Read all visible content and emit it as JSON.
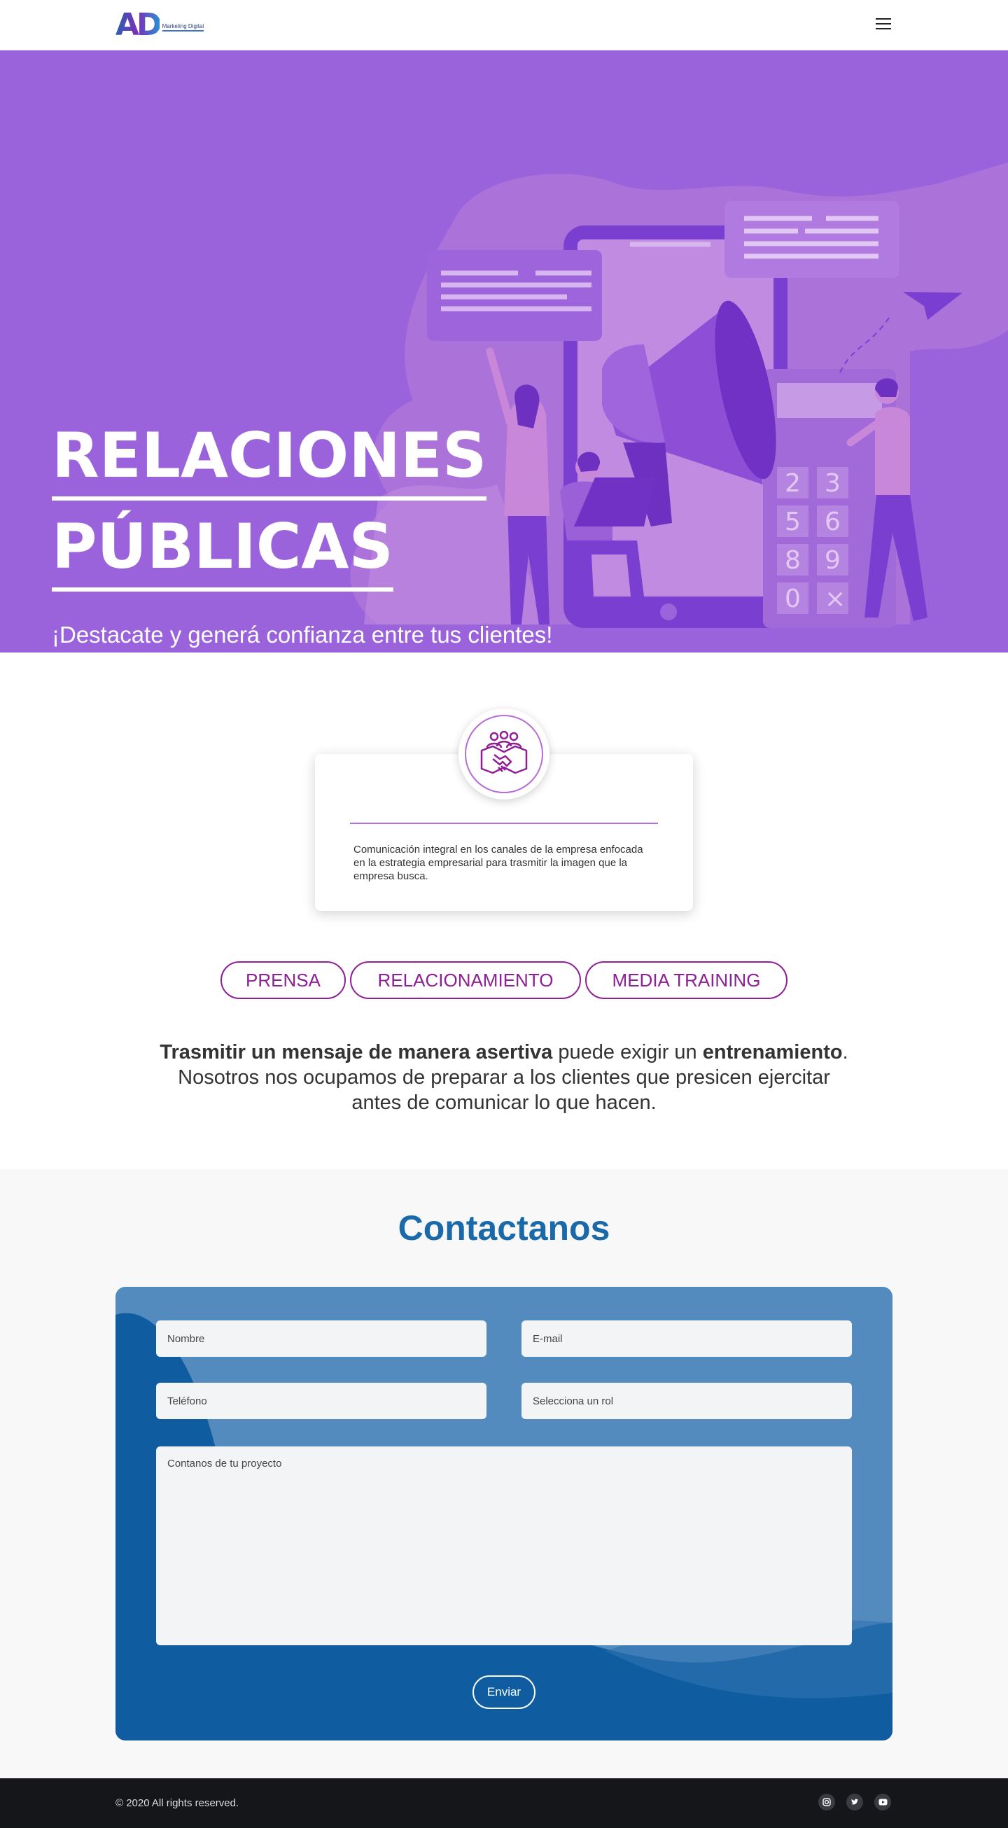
{
  "header": {
    "logo_mark": "AD",
    "logo_text": "Marketing Digital",
    "menu_icon": "hamburger-menu-icon"
  },
  "hero": {
    "title_line1": "RELACIONES",
    "title_line2": "PÚBLICAS",
    "subtitle": "¡Destacate y generá confianza entre tus clientes!",
    "background_color": "#9b63db",
    "illustration": "megaphone-smartphone-people-illustration",
    "phone_keys": [
      "2",
      "3",
      "5",
      "6",
      "8",
      "9",
      "0",
      "×"
    ]
  },
  "service_card": {
    "icon": "handshake-team-icon",
    "description": "Comunicación integral en los canales de la empresa enfocada en la estrategia empresarial para trasmitir la imagen que la empresa busca.",
    "accent_color": "#b86ed8"
  },
  "tabs": [
    {
      "label": "PRENSA"
    },
    {
      "label": "RELACIONAMIENTO"
    },
    {
      "label": "MEDIA TRAINING"
    }
  ],
  "paragraph": {
    "bold1": "Trasmitir un mensaje de manera asertiva",
    "text1": " puede exigir un ",
    "bold2": "entrenamiento",
    "text2": ".",
    "line2": "Nosotros nos ocupamos de preparar a los clientes que presicen ejercitar",
    "line3": "antes de comunicar lo que hacen."
  },
  "contact": {
    "title": "Contactanos",
    "name_placeholder": "Nombre",
    "email_placeholder": "E-mail",
    "phone_placeholder": "Teléfono",
    "role_selected": "Selecciona un rol",
    "project_placeholder": "Contanos de tu proyecto",
    "submit_label": "Enviar",
    "title_color": "#1a6aaa",
    "form_color": "#548bbf"
  },
  "footer": {
    "copyright": "© 2020 All rights reserved.",
    "social_icons": [
      "instagram-icon",
      "twitter-icon",
      "youtube-icon"
    ]
  }
}
